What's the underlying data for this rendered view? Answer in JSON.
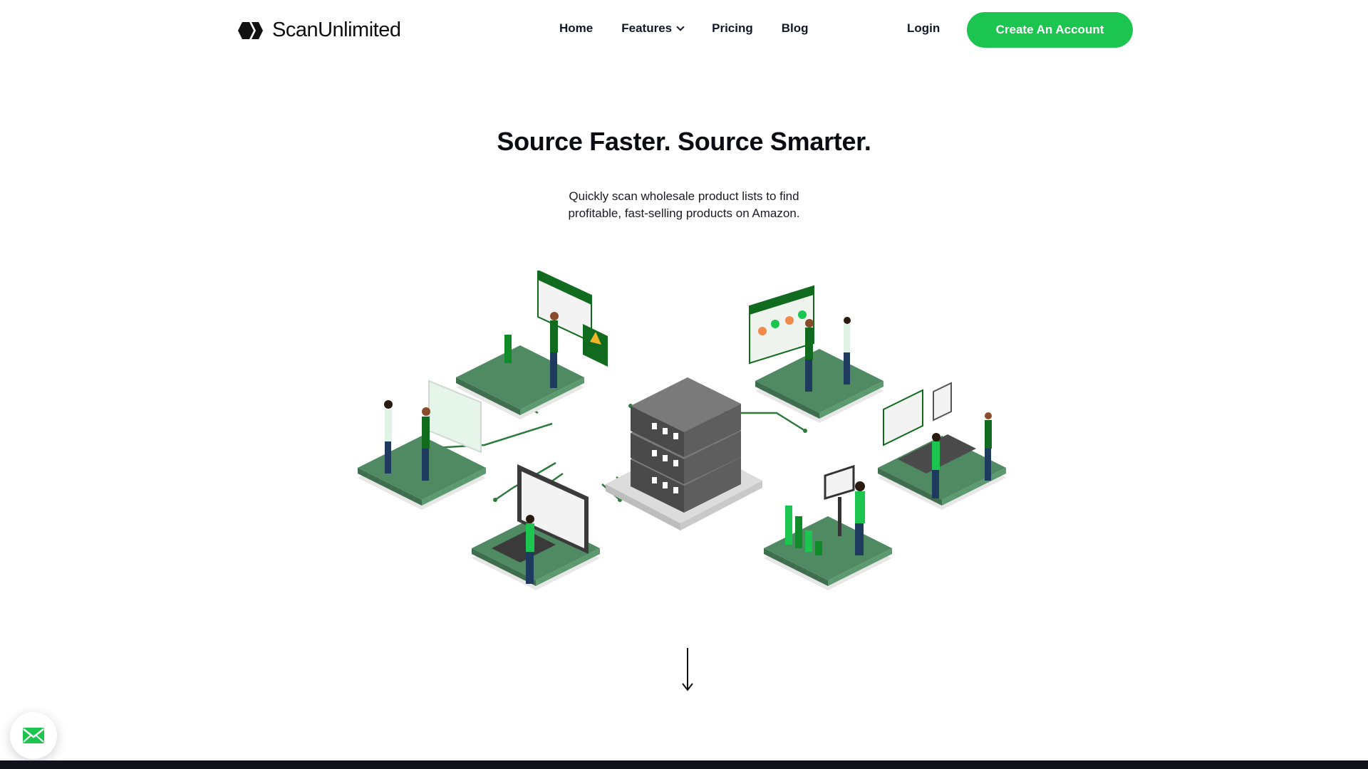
{
  "brand": {
    "name": "ScanUnlimited"
  },
  "nav": {
    "links": [
      {
        "label": "Home"
      },
      {
        "label": "Features"
      },
      {
        "label": "Pricing"
      },
      {
        "label": "Blog"
      }
    ],
    "login_label": "Login",
    "cta_label": "Create An Account"
  },
  "hero": {
    "title": "Source Faster. Source Smarter.",
    "subtitle_line1": "Quickly scan wholesale product lists to find",
    "subtitle_line2": "profitable, fast-selling products on Amazon."
  },
  "icons": {
    "logo": "hexagon-chevron-logo",
    "features_dropdown": "chevron-down-icon",
    "scroll": "arrow-down-icon",
    "chat": "envelope-icon"
  },
  "colors": {
    "accent": "#1cc550",
    "platform": "#4f8a62",
    "dark_green": "#116b1f",
    "text": "#0b0b12",
    "footer": "#12121a"
  }
}
